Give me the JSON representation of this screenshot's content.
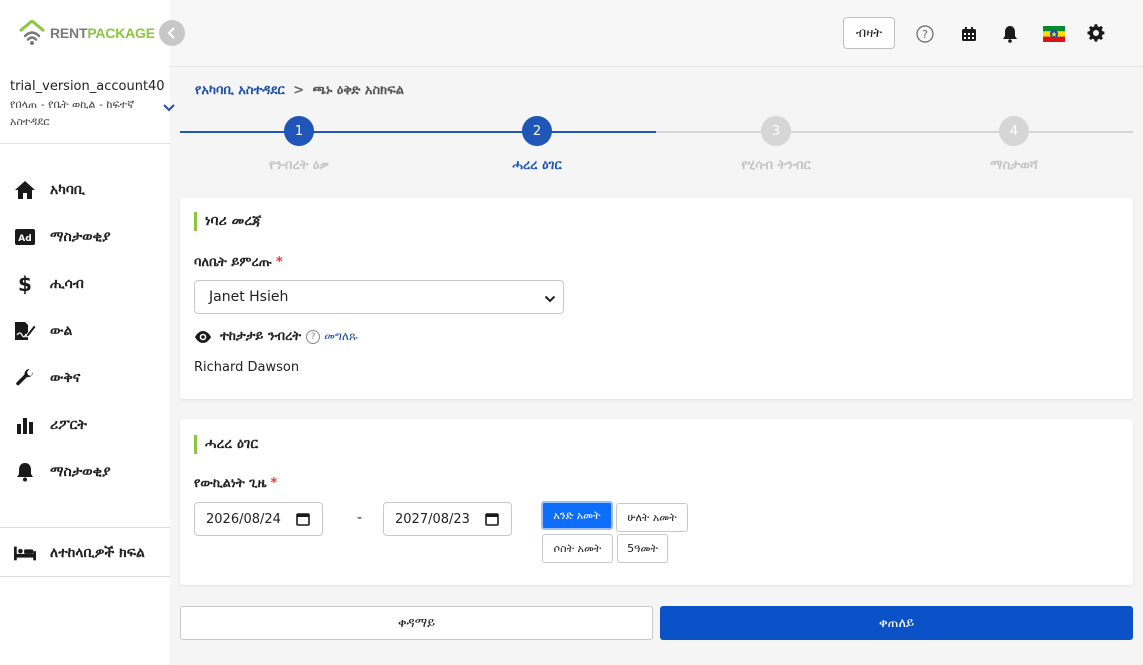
{
  "brand": {
    "rent": "RENT",
    "package": "PACKAGE",
    "accent_green": "#8cc63f"
  },
  "account": {
    "name": "trial_version_account40",
    "role": "የበላጠ - የቤት ወኪል - ከፍተኛ አስተዳደር"
  },
  "sidebar": {
    "items": [
      {
        "label": "አካባቢ",
        "icon": "home-icon"
      },
      {
        "label": "ማስታወቂያ",
        "icon": "ad-icon"
      },
      {
        "label": "ሒሳብ",
        "icon": "dollar-icon"
      },
      {
        "label": "ውል",
        "icon": "contract-sign-icon"
      },
      {
        "label": "ውቅና",
        "icon": "wrench-icon"
      },
      {
        "label": "ሪፖርት",
        "icon": "bar-chart-icon"
      },
      {
        "label": "ማስታወቂያ",
        "icon": "bell-icon"
      }
    ],
    "bottom_item": {
      "label": "ለተከላቢዎች ክፍል",
      "icon": "bed-icon"
    }
  },
  "header": {
    "button_label": "ብዛት",
    "icons": [
      "help-icon",
      "calendar-icon",
      "bell-icon",
      "ethiopia-flag-icon",
      "gear-icon"
    ]
  },
  "breadcrumb": {
    "link": "የአካባቢ አስተዳደር",
    "separator": ">",
    "current": "ጫኑ ዕቅድ አስክፍል"
  },
  "stepper": {
    "steps": [
      {
        "number": "1",
        "label": "የንብረት ዕቃ",
        "state": "done"
      },
      {
        "number": "2",
        "label": "ሓረረ ዕገር",
        "state": "active"
      },
      {
        "number": "3",
        "label": "የሂሳብ ትንብር",
        "state": "pending"
      },
      {
        "number": "4",
        "label": "ማስታወሻ",
        "state": "pending"
      }
    ],
    "colors": {
      "active": "#1f56b8",
      "inactive": "#d6d6d6",
      "inactive_label": "#c4c4c4"
    }
  },
  "owner_card": {
    "title": "ነባሪ መረጃ",
    "owner_label": "ባለቤት ይምረጡ",
    "required_mark": "*",
    "owner_selected": "Janet Hsieh",
    "visible_label": "ተከታታይ ንብረት",
    "help_mark": "?",
    "explain_link": "መግለጹ",
    "visible_value": "Richard Dawson"
  },
  "period_card": {
    "title": "ሓረረ ዕገር",
    "period_label": "የውኪልነት ጊዜ",
    "required_mark": "*",
    "start_date": "2026/08/24",
    "dash": "-",
    "end_date": "2027/08/23",
    "durations": [
      {
        "label": "አንድ አመት",
        "active": true
      },
      {
        "label": "ሁለት አመት",
        "active": false
      },
      {
        "label": "ሶስት አመት",
        "active": false
      },
      {
        "label": "5ዓመት",
        "active": false
      }
    ]
  },
  "actions": {
    "previous": "ቀዳማይ",
    "next": "ቀጠለይ",
    "primary_color": "#0b52c9"
  }
}
